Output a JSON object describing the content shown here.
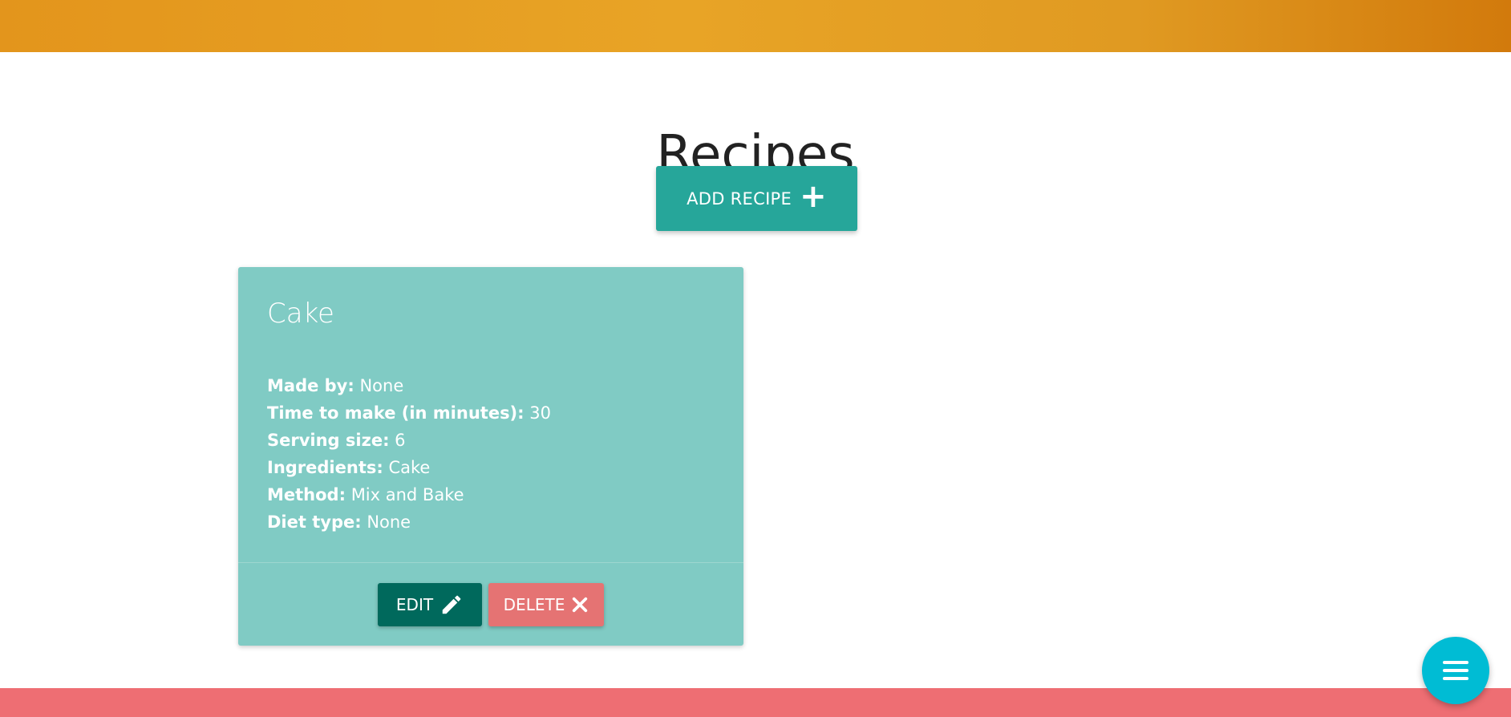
{
  "page": {
    "title": "Recipes"
  },
  "actions": {
    "add_recipe_label": "ADD RECIPE",
    "add_recipe_icon": "plus-icon"
  },
  "recipes": [
    {
      "name": "Cake",
      "details": [
        {
          "label": "Made by:",
          "value": "None"
        },
        {
          "label": "Time to make (in minutes):",
          "value": "30"
        },
        {
          "label": "Serving size:",
          "value": "6"
        },
        {
          "label": "Ingredients:",
          "value": "Cake"
        },
        {
          "label": "Method:",
          "value": "Mix and Bake"
        },
        {
          "label": "Diet type:",
          "value": "None"
        }
      ],
      "edit_label": "EDIT",
      "edit_icon": "pencil-icon",
      "delete_label": "DELETE",
      "delete_icon": "close-icon"
    }
  ],
  "menu": {
    "icon": "hamburger-menu-icon"
  },
  "colors": {
    "banner": "#e8a426",
    "add_button": "#26a69a",
    "card": "#80cbc4",
    "edit_button": "#00695c",
    "delete_button": "#e57373",
    "footer": "#ee6e73",
    "fab": "#00bcd4"
  }
}
